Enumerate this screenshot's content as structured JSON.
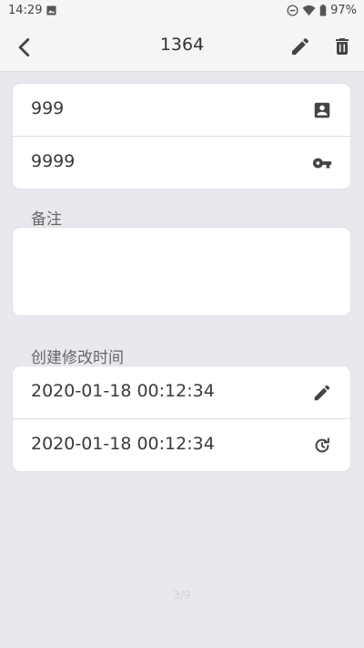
{
  "status_bar": {
    "time": "14:29",
    "battery": "97%"
  },
  "app_bar": {
    "title": "1364"
  },
  "credentials": {
    "account": "999",
    "password": "9999"
  },
  "notes": {
    "label": "备注",
    "value": ""
  },
  "timestamps": {
    "label": "创建修改时间",
    "modified": "2020-01-18 00:12:34",
    "created": "2020-01-18 00:12:34"
  },
  "pager": "3/9",
  "colors": {
    "background": "#e8e8ef",
    "card": "#ffffff",
    "bar": "#f5f5f5"
  }
}
